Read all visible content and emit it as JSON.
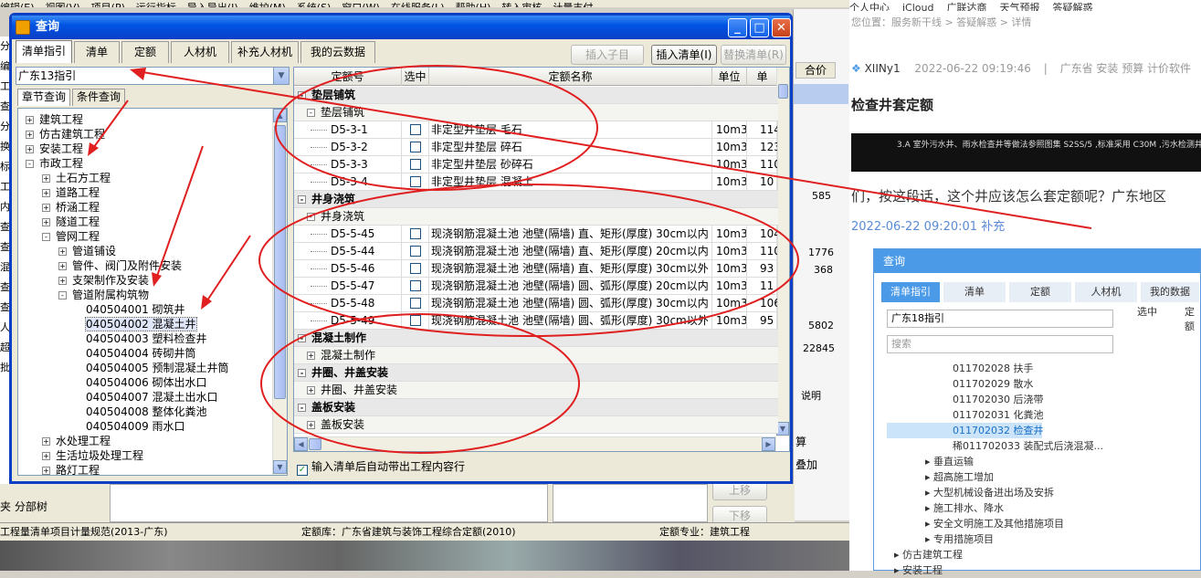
{
  "background_app": {
    "menu_items": [
      "编辑(E)",
      "视图(V)",
      "项目(P)",
      "运行指标",
      "导入导出(I)",
      "维护(M)",
      "系统(S)",
      "窗口(W)",
      "在线服务(L)",
      "帮助(H)",
      "转入审核",
      "计量支付"
    ],
    "status_left": "工程量清单项目计量规范(2013-广东)",
    "status_mid": "定额库：广东省建筑与装饰工程综合定额(2010)",
    "status_right": "定额专业：建筑工程",
    "bottom_tabs": "夹 分部树",
    "right_col_header": "合价",
    "right_values": [
      "585",
      "1776",
      "368",
      "5802",
      "22845"
    ],
    "right_label_desc": "说明",
    "up_button": "上移",
    "down_button": "下移",
    "side_text": [
      "算",
      "叠加"
    ],
    "left_edge_letters": [
      "分",
      "编",
      "工",
      "查",
      "分",
      "换",
      "标",
      "工",
      "内",
      "查",
      "查",
      "混",
      "查",
      "查",
      "人",
      "超",
      "批"
    ]
  },
  "dialog": {
    "title": "查询",
    "tabs": [
      "清单指引",
      "清单",
      "定额",
      "人材机",
      "补充人材机",
      "我的云数据"
    ],
    "active_tab": 0,
    "buttons": {
      "insert_child": "插入子目",
      "insert_list": "插入清单(I)",
      "replace_list": "替换清单(R)"
    },
    "library_select": "广东13指引",
    "subtabs": [
      "章节查询",
      "条件查询"
    ],
    "tree": [
      {
        "label": "建筑工程",
        "level": 0,
        "toggle": "+"
      },
      {
        "label": "仿古建筑工程",
        "level": 0,
        "toggle": "+"
      },
      {
        "label": "安装工程",
        "level": 0,
        "toggle": "+"
      },
      {
        "label": "市政工程",
        "level": 0,
        "toggle": "-"
      },
      {
        "label": "土石方工程",
        "level": 1,
        "toggle": "+"
      },
      {
        "label": "道路工程",
        "level": 1,
        "toggle": "+"
      },
      {
        "label": "桥涵工程",
        "level": 1,
        "toggle": "+"
      },
      {
        "label": "隧道工程",
        "level": 1,
        "toggle": "+"
      },
      {
        "label": "管网工程",
        "level": 1,
        "toggle": "-"
      },
      {
        "label": "管道铺设",
        "level": 2,
        "toggle": "+"
      },
      {
        "label": "管件、阀门及附件安装",
        "level": 2,
        "toggle": "+"
      },
      {
        "label": "支架制作及安装",
        "level": 2,
        "toggle": "+"
      },
      {
        "label": "管道附属构筑物",
        "level": 2,
        "toggle": "-"
      },
      {
        "label": "040504001  砌筑井",
        "level": 3,
        "toggle": ""
      },
      {
        "label": "040504002  混凝土井",
        "level": 3,
        "toggle": "",
        "selected": true
      },
      {
        "label": "040504003  塑料检查井",
        "level": 3,
        "toggle": ""
      },
      {
        "label": "040504004  砖砌井筒",
        "level": 3,
        "toggle": ""
      },
      {
        "label": "040504005  预制混凝土井筒",
        "level": 3,
        "toggle": ""
      },
      {
        "label": "040504006  砌体出水口",
        "level": 3,
        "toggle": ""
      },
      {
        "label": "040504007  混凝土出水口",
        "level": 3,
        "toggle": ""
      },
      {
        "label": "040504008  整体化粪池",
        "level": 3,
        "toggle": ""
      },
      {
        "label": "040504009  雨水口",
        "level": 3,
        "toggle": ""
      },
      {
        "label": "水处理工程",
        "level": 1,
        "toggle": "+"
      },
      {
        "label": "生活垃圾处理工程",
        "level": 1,
        "toggle": "+"
      },
      {
        "label": "路灯工程",
        "level": 1,
        "toggle": "+"
      }
    ],
    "grid_headers": [
      "定额号",
      "选中",
      "定额名称",
      "单位",
      "单"
    ],
    "grid_rows": [
      {
        "kind": "sec",
        "toggle": "-",
        "name": "垫层铺筑"
      },
      {
        "kind": "sub",
        "toggle": "-",
        "name": "垫层铺筑"
      },
      {
        "kind": "item",
        "code": "D5-3-1",
        "name": "非定型井垫层  毛石",
        "unit": "10m3",
        "price": "114"
      },
      {
        "kind": "item",
        "code": "D5-3-2",
        "name": "非定型井垫层  碎石",
        "unit": "10m3",
        "price": "123"
      },
      {
        "kind": "item",
        "code": "D5-3-3",
        "name": "非定型井垫层  砂碎石",
        "unit": "10m3",
        "price": "110"
      },
      {
        "kind": "item",
        "code": "D5-3-4",
        "name": "非定型井垫层  混凝土",
        "unit": "10m3",
        "price": "10"
      },
      {
        "kind": "sec",
        "toggle": "-",
        "name": "井身浇筑"
      },
      {
        "kind": "sub",
        "toggle": "-",
        "name": "井身浇筑"
      },
      {
        "kind": "item",
        "code": "D5-5-45",
        "name": "现浇钢筋混凝土池  池壁(隔墙) 直、矩形(厚度) 30cm以内",
        "unit": "10m3",
        "price": "104"
      },
      {
        "kind": "item",
        "code": "D5-5-44",
        "name": "现浇钢筋混凝土池  池壁(隔墙) 直、矩形(厚度) 20cm以内",
        "unit": "10m3",
        "price": "110"
      },
      {
        "kind": "item",
        "code": "D5-5-46",
        "name": "现浇钢筋混凝土池  池壁(隔墙) 直、矩形(厚度) 30cm以外",
        "unit": "10m3",
        "price": "93"
      },
      {
        "kind": "item",
        "code": "D5-5-47",
        "name": "现浇钢筋混凝土池  池壁(隔墙) 圆、弧形(厚度) 20cm以内",
        "unit": "10m3",
        "price": "11"
      },
      {
        "kind": "item",
        "code": "D5-5-48",
        "name": "现浇钢筋混凝土池  池壁(隔墙) 圆、弧形(厚度) 30cm以内",
        "unit": "10m3",
        "price": "106"
      },
      {
        "kind": "item",
        "code": "D5-5-49",
        "name": "现浇钢筋混凝土池  池壁(隔墙) 圆、弧形(厚度) 30cm以外",
        "unit": "10m3",
        "price": "95"
      },
      {
        "kind": "sec",
        "toggle": "-",
        "name": "混凝土制作"
      },
      {
        "kind": "sub",
        "toggle": "+",
        "name": "混凝土制作"
      },
      {
        "kind": "sec",
        "toggle": "-",
        "name": "井圈、井盖安装"
      },
      {
        "kind": "sub",
        "toggle": "+",
        "name": "井圈、井盖安装"
      },
      {
        "kind": "sec",
        "toggle": "-",
        "name": "盖板安装"
      },
      {
        "kind": "sub",
        "toggle": "+",
        "name": "盖板安装"
      }
    ],
    "auto_include_label": "输入清单后自动带出工程内容行"
  },
  "web_page": {
    "top_links": [
      "个人中心",
      "iCloud",
      "广联达商",
      "天气预报",
      "答疑解惑"
    ],
    "breadcrumb": "您位置：服务新干线 > 答疑解惑 > 详情",
    "author": "XIINy1",
    "post_time": "2022-06-22 09:19:46",
    "tags": "广东省  安装  预算  计价软件",
    "question_title": "检查井套定额",
    "image_text": "3.A   室外污水井、雨水检查井等做法参照图集  S2SS/5 ,标准采用  C30M ,污水检测井,为建筑砖砌标准井规格应以设计为准",
    "question_text": "们，按这段话，这个井应该怎么套定额呢？广东地区",
    "followup_time": "2022-06-22 09:20:01 补充",
    "embedded_dialog": {
      "title": "查询",
      "tabs": [
        "清单指引",
        "清单",
        "定额",
        "人材机",
        "我的数据"
      ],
      "library": "广东18指引",
      "search_placeholder": "搜索",
      "col_headers": [
        "选中",
        "定额"
      ],
      "nodes": [
        {
          "label": "011702028  扶手",
          "indent": 1
        },
        {
          "label": "011702029  散水",
          "indent": 1
        },
        {
          "label": "011702030  后浇带",
          "indent": 1
        },
        {
          "label": "011702031  化粪池",
          "indent": 1
        },
        {
          "label": "011702032  检查井",
          "indent": 1,
          "selected": true
        },
        {
          "label": "稀011702033  装配式后浇混凝...",
          "indent": 1
        },
        {
          "label": "垂直运输",
          "indent": 0
        },
        {
          "label": "超高施工增加",
          "indent": 0
        },
        {
          "label": "大型机械设备进出场及安拆",
          "indent": 0
        },
        {
          "label": "施工排水、降水",
          "indent": 0
        },
        {
          "label": "安全文明施工及其他措施项目",
          "indent": 0
        },
        {
          "label": "专用措施项目",
          "indent": 0
        },
        {
          "label": "仿古建筑工程",
          "indent": -1
        },
        {
          "label": "安装工程",
          "indent": -1
        }
      ]
    }
  },
  "annotation_color": "#e02020"
}
